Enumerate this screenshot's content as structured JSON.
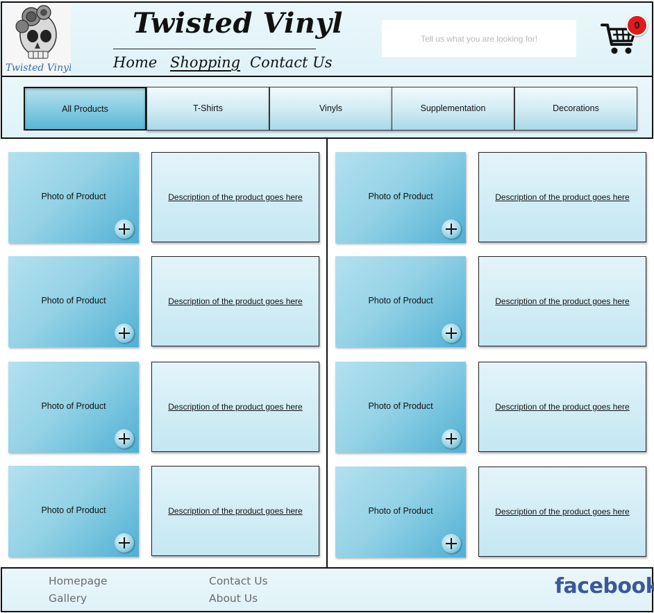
{
  "header": {
    "logo_text": "Twisted Vinyl",
    "brand_title": "Twisted Vinyl",
    "nav": {
      "home": "Home",
      "shopping": "Shopping",
      "contact": "Contact Us"
    },
    "search_placeholder": "Tell us what you are looking for!",
    "cart_count": "0",
    "cart_icon": "shopping-cart-icon"
  },
  "tabs": [
    {
      "label": "All Products",
      "active": true
    },
    {
      "label": "T-Shirts",
      "active": false
    },
    {
      "label": "Vinyls",
      "active": false
    },
    {
      "label": "Supplementation",
      "active": false
    },
    {
      "label": "Decorations",
      "active": false
    }
  ],
  "products": [
    {
      "photo": "Photo of Product",
      "description": "Description of the product goes here"
    },
    {
      "photo": "Photo of Product",
      "description": "Description of the product goes here"
    },
    {
      "photo": "Photo of Product",
      "description": "Description of the product goes here"
    },
    {
      "photo": "Photo of Product",
      "description": "Description of the product goes here"
    },
    {
      "photo": "Photo of Product",
      "description": "Description of the product goes here"
    },
    {
      "photo": "Photo of Product",
      "description": "Description of the product goes here"
    },
    {
      "photo": "Photo of Product",
      "description": "Description of the product goes here"
    },
    {
      "photo": "Photo of Product",
      "description": "Description of the product goes here"
    }
  ],
  "footer": {
    "homepage": "Homepage",
    "gallery": "Gallery",
    "contact": "Contact Us",
    "about": "About Us",
    "facebook": "facebook"
  },
  "colors": {
    "accent": "#5ab6d4",
    "badge": "#e01b1b",
    "facebook": "#3b5998"
  }
}
